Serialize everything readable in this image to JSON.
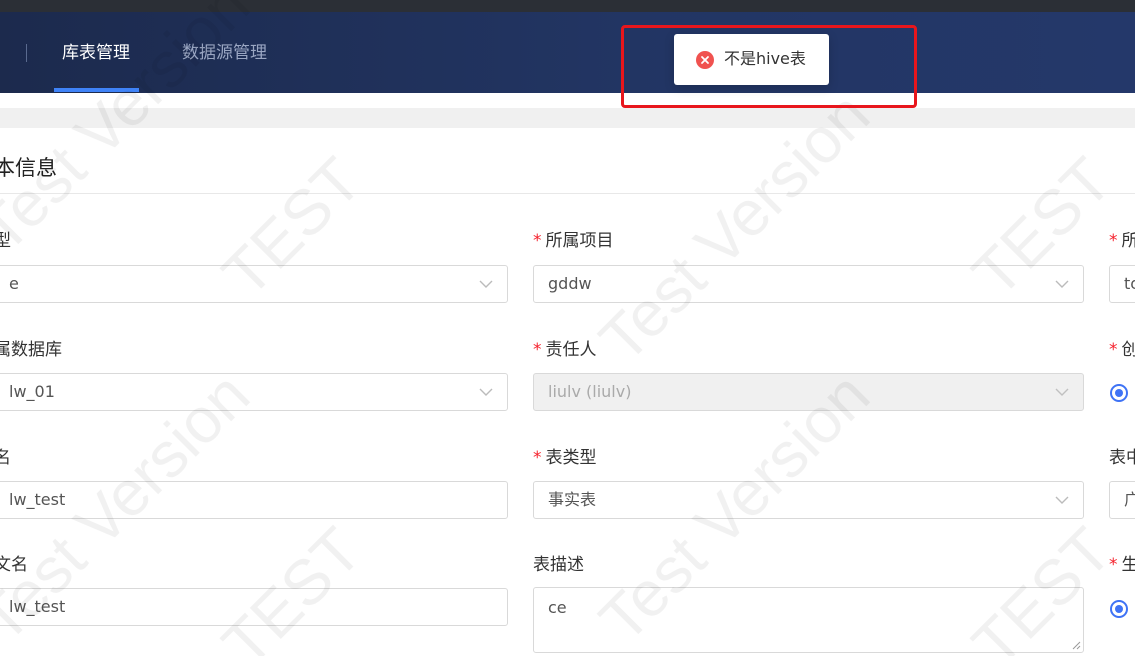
{
  "nav": {
    "tabs": [
      {
        "label": "库表管理",
        "active": true
      },
      {
        "label": "数据源管理",
        "active": false
      }
    ]
  },
  "toast": {
    "icon": "error-circle-icon",
    "message": "不是hive表",
    "color": "#f0524f"
  },
  "section": {
    "title": "本信息"
  },
  "form": {
    "col1": {
      "type_label": "型",
      "type_value": "e",
      "db_label": "属数据库",
      "db_value": "lw_01",
      "name_label": "名",
      "name_value": "lw_test",
      "cn_name_label": "文名",
      "cn_name_value": "lw_test"
    },
    "col2": {
      "project_label": "所属项目",
      "project_value": "gddw",
      "owner_label": "责任人",
      "owner_value": "liulv (liulv)",
      "table_type_label": "表类型",
      "table_type_value": "事实表",
      "desc_label": "表描述",
      "desc_value": "ce"
    },
    "col3": {
      "label1": "所",
      "value1": "to",
      "label2": "创",
      "label3": "表中",
      "value3": "广",
      "label4": "生"
    },
    "required_mark": "*"
  },
  "watermark": {
    "texts": [
      "TEST",
      "Test Version"
    ]
  },
  "colors": {
    "accent": "#3f73f5",
    "required": "#f5222d",
    "highlight": "#e8161c"
  }
}
